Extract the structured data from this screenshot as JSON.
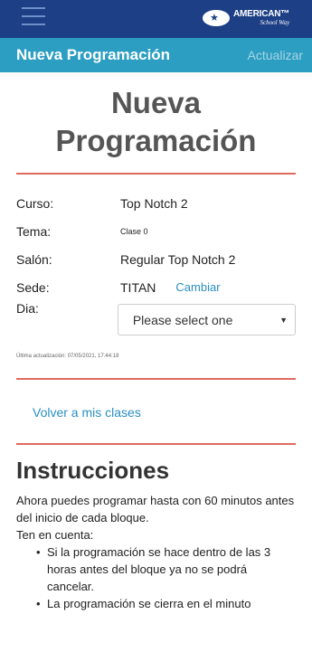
{
  "topbar": {
    "brand_main": "AMERICAN™",
    "brand_sub": "School Way",
    "colors": {
      "background": "#1d3f86"
    }
  },
  "header": {
    "title": "Nueva Programación",
    "action": "Actualizar",
    "colors": {
      "background": "#2c9ec2"
    }
  },
  "main": {
    "title": "Nueva Programación",
    "accent_color": "#e06a5e",
    "details": {
      "curso_label": "Curso:",
      "curso_value": "Top Notch 2",
      "tema_label": "Tema:",
      "tema_value": "Clase 0",
      "salon_label": "Salón:",
      "salon_value": "Regular Top Notch 2",
      "sede_label": "Sede:",
      "sede_value": "TITAN",
      "sede_action": "Cambiar",
      "dia_label": "Dia:",
      "dia_selected": "Please select one"
    },
    "last_update": "Última actualización: 07/05/2021, 17:44:18",
    "back_link": "Volver a mis clases",
    "instructions": {
      "title": "Instrucciones",
      "text1": "Ahora puedes programar hasta con 60 minutos antes del inicio de cada bloque.",
      "text2": "Ten en cuenta:",
      "bullets": [
        "Si la programación se hace dentro de las 3 horas antes del bloque ya no se podrá cancelar.",
        "La programación se cierra en el minuto"
      ]
    },
    "link_color": "#2b8fc2"
  }
}
